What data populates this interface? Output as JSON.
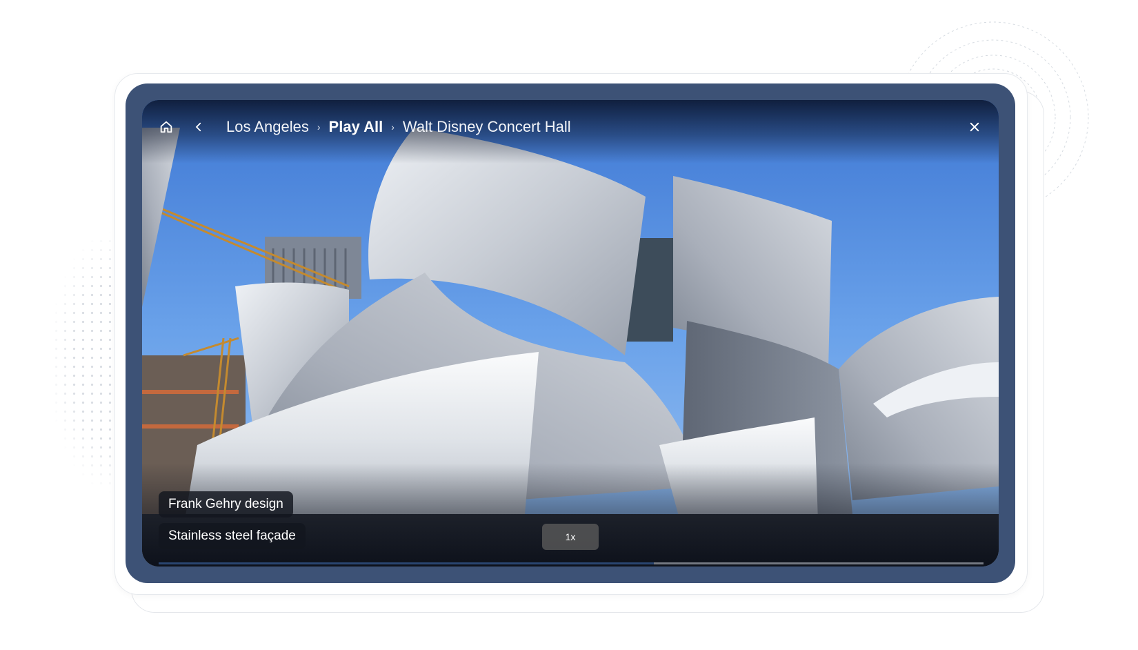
{
  "breadcrumb": {
    "items": [
      {
        "label": "Los Angeles",
        "bold": false
      },
      {
        "label": "Play All",
        "bold": true
      },
      {
        "label": "Walt Disney Concert Hall",
        "bold": false
      }
    ],
    "separator": "›"
  },
  "icons": {
    "home": "home-icon",
    "back": "chevron-left-icon",
    "close": "close-icon"
  },
  "tags": [
    {
      "label": "Frank Gehry design"
    },
    {
      "label": "Stainless steel façade"
    }
  ],
  "playback": {
    "speed_label": "1x",
    "progress": 0.6
  },
  "colors": {
    "frame": "#3d5276",
    "progress": "#2a4670"
  }
}
